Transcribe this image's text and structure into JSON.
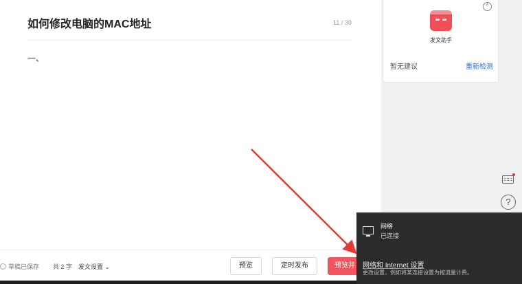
{
  "editor": {
    "title": "如何修改电脑的MAC地址",
    "title_counter": "11 / 30",
    "body_text": "一、"
  },
  "assistant": {
    "icon": "robot-icon",
    "label": "发文助手",
    "no_suggestion": "暂无建议",
    "recheck": "重新检测",
    "collapse_icon": "chevron-up-icon"
  },
  "side_tools": {
    "keyboard_icon": "keyboard-icon",
    "help_icon": "help-icon",
    "help_glyph": "?"
  },
  "footer": {
    "saved_text": "草稿已保存",
    "word_count": "共 2 字",
    "publish_settings": "发文设置 ⌄",
    "preview_button": "预览",
    "schedule_button": "定时发布",
    "publish_button": "预览并"
  },
  "network_flyout": {
    "icon": "monitor-network-icon",
    "network_name": "网络",
    "status": "已连接",
    "settings_link": "网络和 Internet 设置",
    "settings_desc": "更改设置，例如将某连接设置为按流量计费。"
  },
  "colors": {
    "accent_red": "#f2555d",
    "link_blue": "#2f6fd6",
    "arrow_red": "#e53935",
    "flyout_bg": "#2b2b2b"
  }
}
